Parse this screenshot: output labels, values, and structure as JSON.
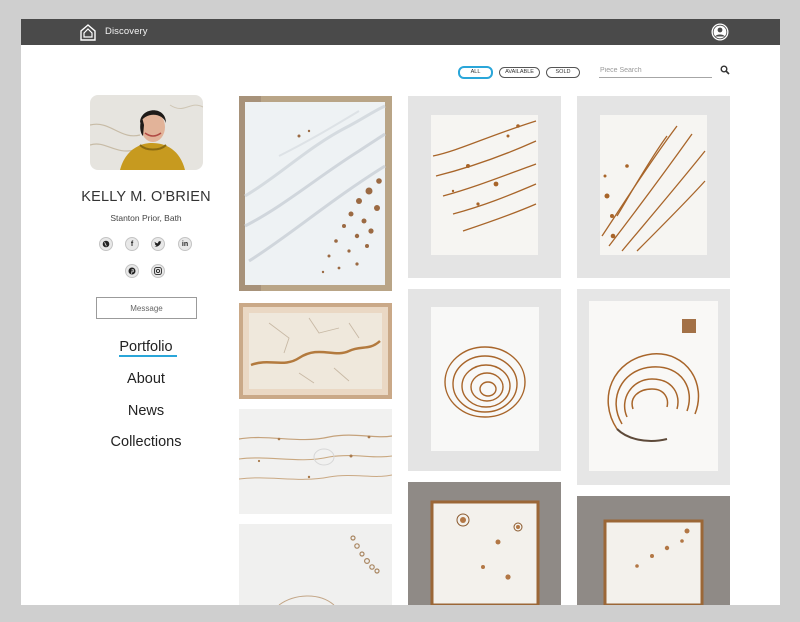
{
  "app": {
    "brand": "Discovery"
  },
  "filters": {
    "items": [
      "ALL",
      "AVAILABLE",
      "SOLD"
    ],
    "active": "ALL"
  },
  "search": {
    "placeholder": "Piece Search",
    "value": ""
  },
  "profile": {
    "name": "KELLY M. O'BRIEN",
    "location": "Stanton Prior, Bath",
    "social_icons": [
      "globe-icon",
      "facebook-icon",
      "twitter-icon",
      "linkedin-icon",
      "pinterest-icon",
      "instagram-icon"
    ],
    "message_label": "Message"
  },
  "nav": {
    "items": [
      "Portfolio",
      "About",
      "News",
      "Collections"
    ],
    "active": "Portfolio"
  },
  "gallery": {
    "artworks": [
      "burnt-paper-relief-diagonal-lines-dots",
      "framed-paper-relief-river",
      "paper-relief-horizontal-lines",
      "paper-relief-circles-arc",
      "burnt-lines-diagonal-1",
      "burnt-lines-diagonal-2",
      "burnt-spiral",
      "burnt-concentric-arcs",
      "burnt-edge-sheet-1",
      "burnt-edge-sheet-2"
    ]
  },
  "colors": {
    "topbar": "#4a4a4a",
    "accent": "#2aa6d9",
    "burn": "#a8652a"
  }
}
